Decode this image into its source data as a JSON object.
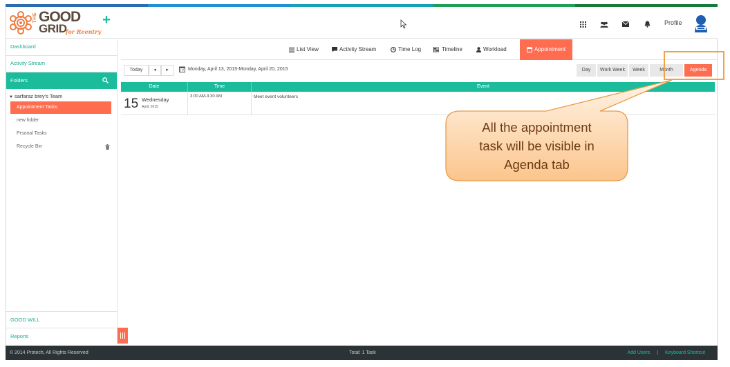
{
  "brand": {
    "logo_the": "THE",
    "logo_good": "GOOD",
    "logo_grid": "GRID",
    "logo_tagline": "for Reentry",
    "colors": [
      "#2b6cb0",
      "#1f8fd6",
      "#17a2b8",
      "#1e9e57",
      "#167a3d"
    ]
  },
  "header": {
    "profile_label": "Profile",
    "icons": [
      "apps-grid-icon",
      "users-icon",
      "envelope-icon",
      "bell-icon"
    ]
  },
  "sidebar": {
    "dashboard": "Dashboard",
    "activity_stream": "Activity Stream",
    "folders_label": "Folders",
    "team_label": "sarfaraz brey's Team",
    "items": [
      {
        "label": "Appointment Tasks",
        "active": true
      },
      {
        "label": "new folder"
      },
      {
        "label": "Prsonal Tasks"
      },
      {
        "label": "Recycle Bin"
      }
    ],
    "good_will": "GOOD WILL",
    "reports": "Reports"
  },
  "tabs": [
    {
      "label": "List View",
      "icon": "list-icon"
    },
    {
      "label": "Activity Stream",
      "icon": "comment-icon"
    },
    {
      "label": "Time Log",
      "icon": "clock-icon"
    },
    {
      "label": "Timeline",
      "icon": "timeline-icon"
    },
    {
      "label": "Workload",
      "icon": "user-icon"
    },
    {
      "label": "Appointment",
      "icon": "calendar-icon",
      "active": true
    }
  ],
  "toolbar": {
    "today": "Today",
    "prev": "◂",
    "next": "▸",
    "range": "Monday, April 13, 2015-Monday, April 20, 2015",
    "views": [
      {
        "label": "Day"
      },
      {
        "label": "Work Week"
      },
      {
        "label": "Week"
      },
      {
        "label": "Month"
      },
      {
        "label": "Agenda",
        "active": true
      }
    ]
  },
  "agenda": {
    "columns": [
      "Date",
      "Time",
      "Event"
    ],
    "rows": [
      {
        "day": "15",
        "weekday": "Wednesday",
        "month": "April, 2015",
        "time": "3:00 AM-3:30 AM",
        "event": "Meet event volunteers"
      }
    ]
  },
  "annotation": {
    "text_line1": "All the appointment",
    "text_line2": "task will be visible in",
    "text_line3": "Agenda tab"
  },
  "footer": {
    "copyright": "© 2014 Protech, All Rights Reserved",
    "total": "Total: 1 Task",
    "add_users": "Add Users",
    "separator": "|",
    "keyboard_shortcut": "Keyboard Shortcut"
  }
}
